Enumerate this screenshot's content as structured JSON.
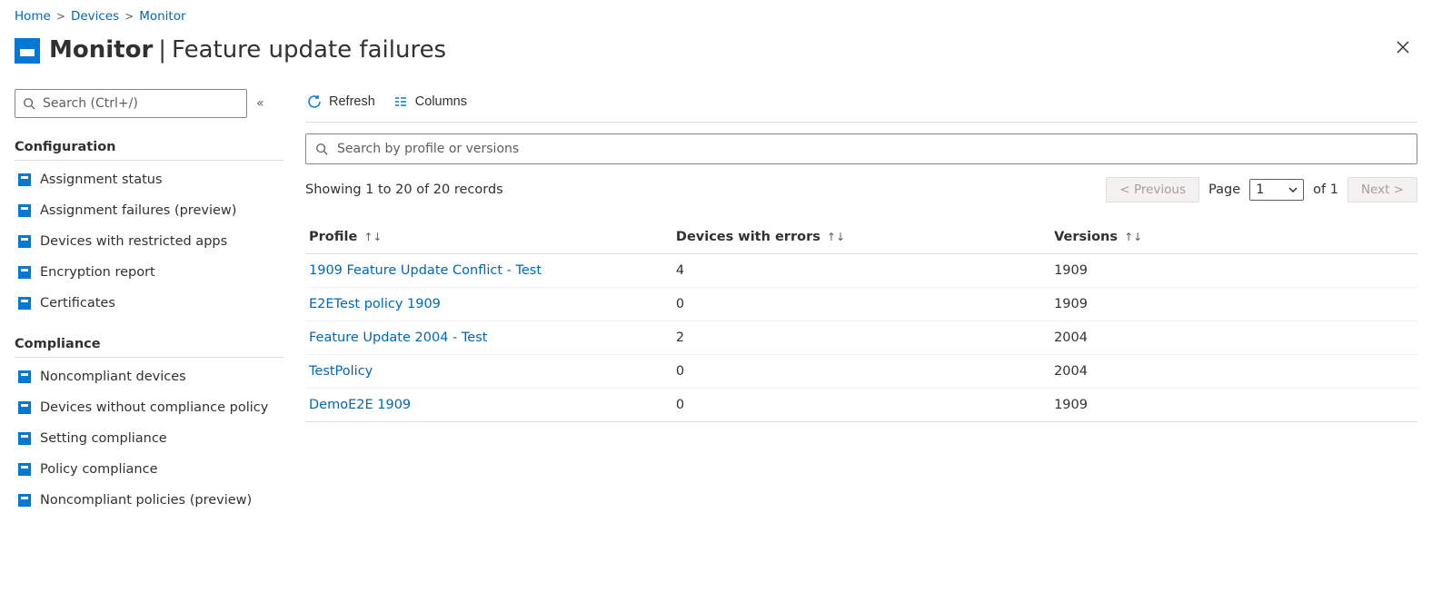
{
  "breadcrumb": {
    "items": [
      "Home",
      "Devices",
      "Monitor"
    ]
  },
  "header": {
    "title_main": "Monitor",
    "title_sub": "Feature update failures",
    "divider": "|"
  },
  "sidebar": {
    "search_placeholder": "Search (Ctrl+/)",
    "groups": [
      {
        "label": "Configuration",
        "items": [
          {
            "label": "Assignment status"
          },
          {
            "label": "Assignment failures (preview)"
          },
          {
            "label": "Devices with restricted apps"
          },
          {
            "label": "Encryption report"
          },
          {
            "label": "Certificates"
          }
        ]
      },
      {
        "label": "Compliance",
        "items": [
          {
            "label": "Noncompliant devices"
          },
          {
            "label": "Devices without compliance policy"
          },
          {
            "label": "Setting compliance"
          },
          {
            "label": "Policy compliance"
          },
          {
            "label": "Noncompliant policies (preview)"
          }
        ]
      }
    ]
  },
  "toolbar": {
    "refresh_label": "Refresh",
    "columns_label": "Columns"
  },
  "search_main": {
    "placeholder": "Search by profile or versions"
  },
  "status": {
    "text": "Showing 1 to 20 of 20 records"
  },
  "pager": {
    "prev_label": "< Previous",
    "page_label": "Page",
    "current": "1",
    "of": "of 1",
    "next_label": "Next >"
  },
  "table": {
    "columns": [
      {
        "label": "Profile",
        "sortable": true
      },
      {
        "label": "Devices with errors",
        "sortable": true
      },
      {
        "label": "Versions",
        "sortable": true
      }
    ],
    "sort_glyph": "↑↓",
    "rows": [
      {
        "profile": "1909 Feature Update Conflict - Test",
        "devices_with_errors": "4",
        "versions": "1909"
      },
      {
        "profile": "E2ETest policy 1909",
        "devices_with_errors": "0",
        "versions": "1909"
      },
      {
        "profile": "Feature Update 2004 - Test",
        "devices_with_errors": "2",
        "versions": "2004"
      },
      {
        "profile": "TestPolicy",
        "devices_with_errors": "0",
        "versions": "2004"
      },
      {
        "profile": "DemoE2E 1909",
        "devices_with_errors": "0",
        "versions": "1909"
      }
    ]
  }
}
